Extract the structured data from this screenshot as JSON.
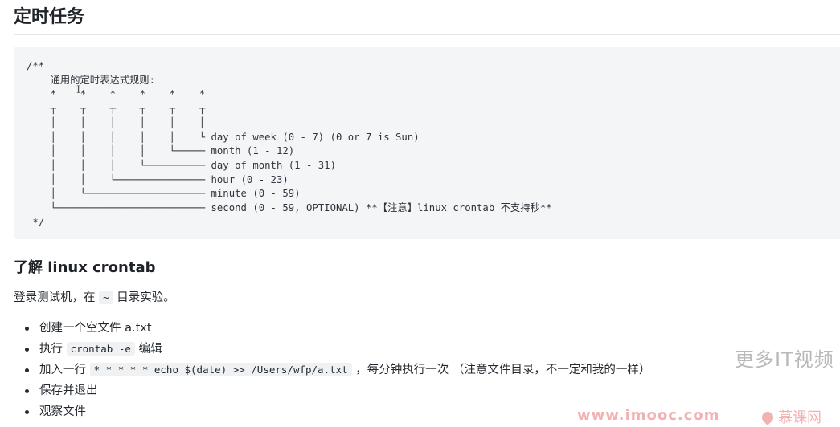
{
  "heading": "定时任务",
  "code_block": {
    "lines": [
      "/**",
      "    通用的定时表达式规则:",
      "    *    *    *    *    *    *",
      "    ┬    ┬    ┬    ┬    ┬    ┬",
      "    │    │    │    │    │    │",
      "    │    │    │    │    │    └ day of week (0 - 7) (0 or 7 is Sun)",
      "    │    │    │    │    └───── month (1 - 12)",
      "    │    │    │    └────────── day of month (1 - 31)",
      "    │    │    └─────────────── hour (0 - 23)",
      "    │    └──────────────────── minute (0 - 59)",
      "    └───────────────────────── second (0 - 59, OPTIONAL) **【注意】linux crontab 不支持秒**",
      " */"
    ]
  },
  "cursor_glyph": "I",
  "section": {
    "title": "了解 linux crontab",
    "intro_before": "登录测试机，在",
    "intro_code": "~",
    "intro_after": "目录实验。",
    "steps": [
      {
        "text": "创建一个空文件 a.txt"
      },
      {
        "before": "执行",
        "code": "crontab -e",
        "after": "编辑"
      },
      {
        "before": "加入一行",
        "code": "* * * * * echo $(date) >> /Users/wfp/a.txt",
        "after": "，每分钟执行一次 （注意文件目录，不一定和我的一样）"
      },
      {
        "text": "保存并退出"
      },
      {
        "text": "观察文件"
      }
    ]
  },
  "watermark": {
    "text": "更多IT视频",
    "url": "www.imooc.com",
    "logo": "慕课网"
  }
}
